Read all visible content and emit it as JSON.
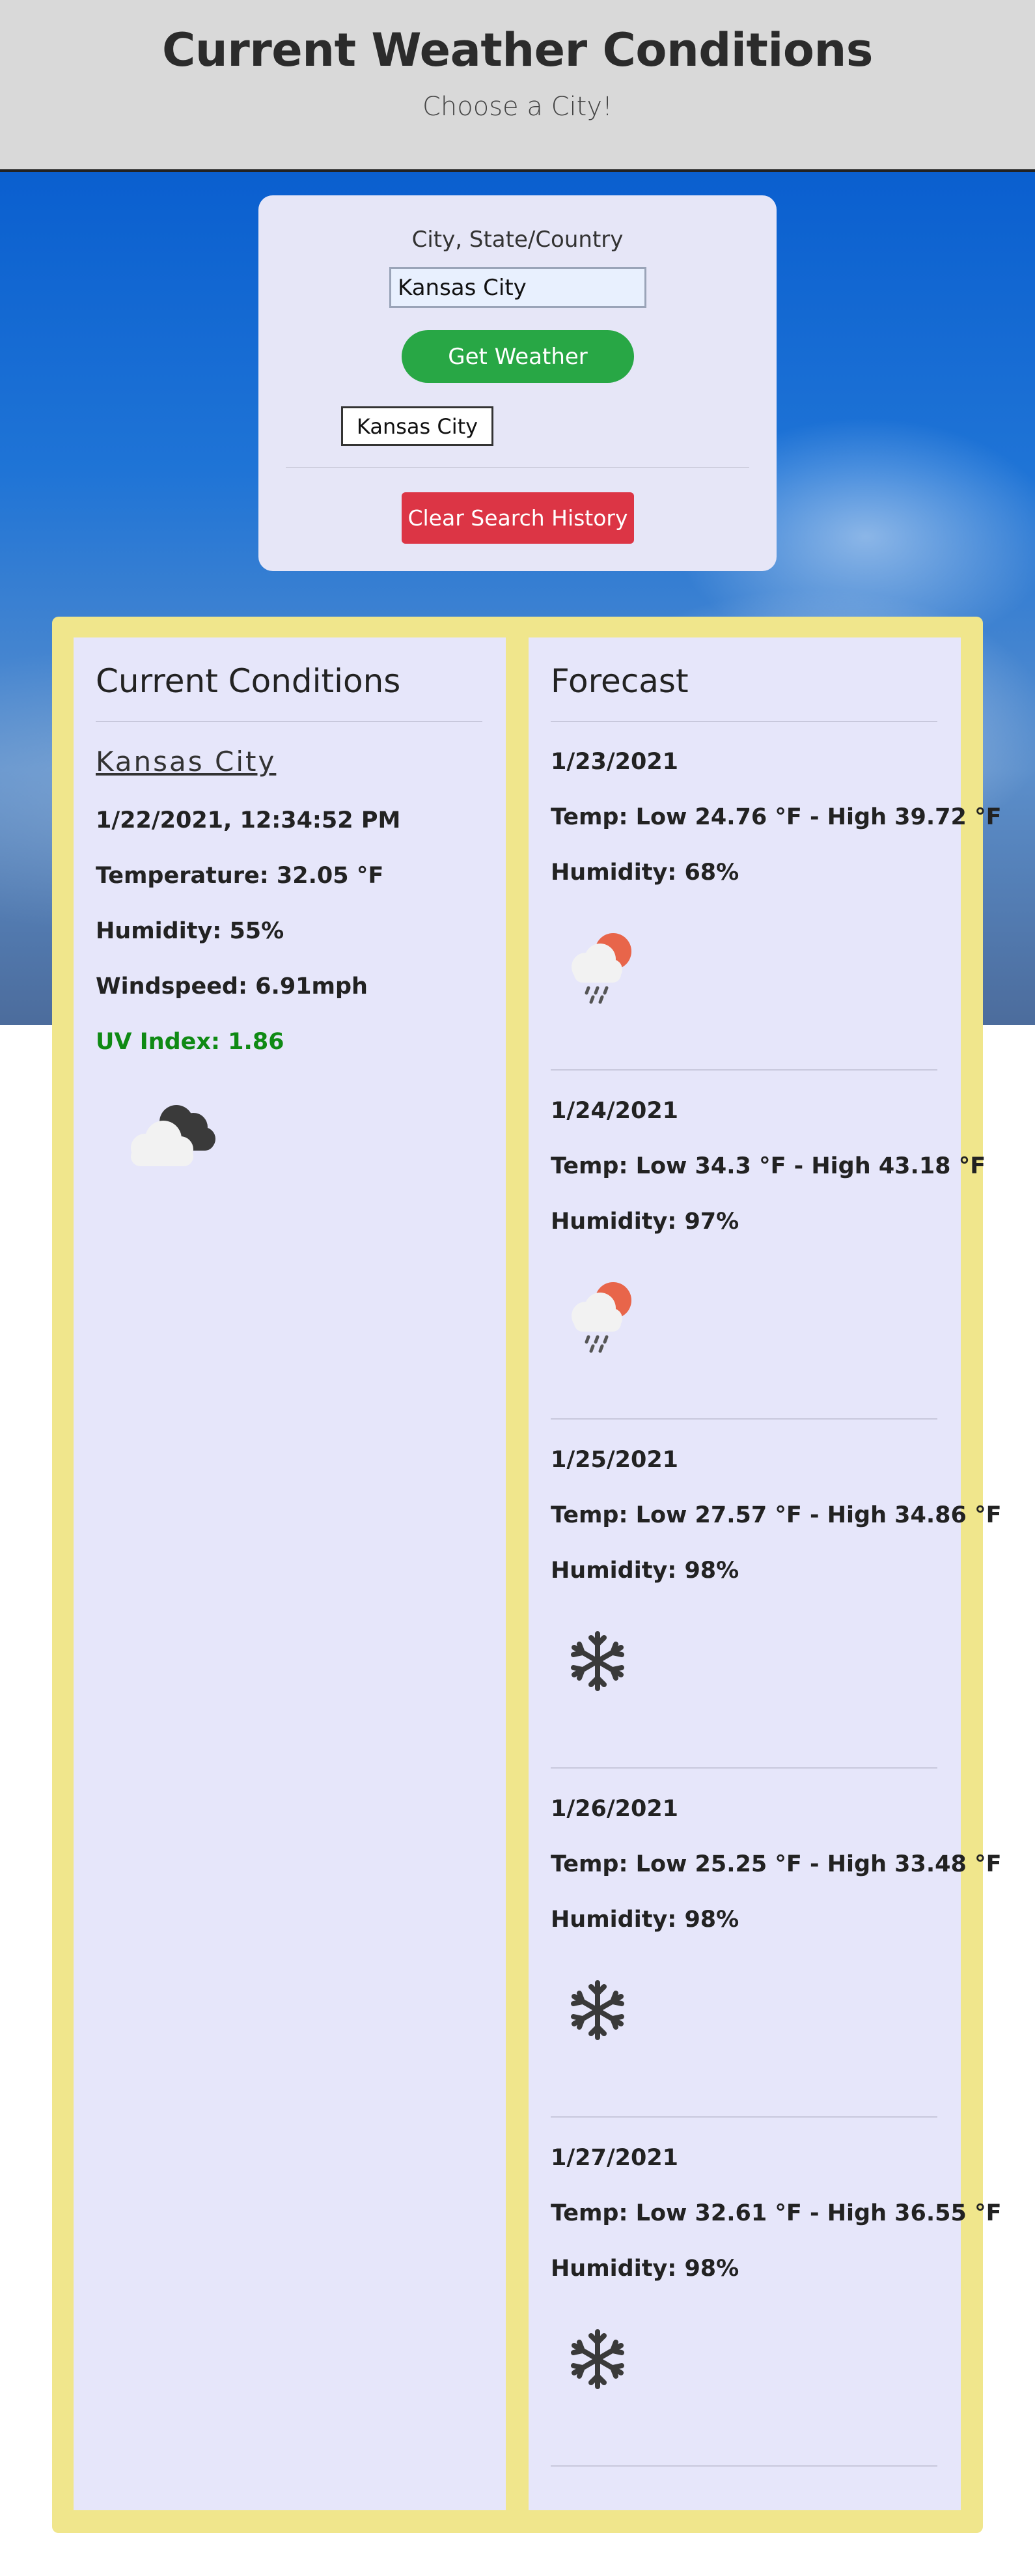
{
  "header": {
    "title": "Current Weather Conditions",
    "subtitle": "Choose a City!"
  },
  "search": {
    "label": "City, State/Country",
    "value": "Kansas City",
    "get_button": "Get Weather",
    "history": [
      "Kansas City"
    ],
    "clear_button": "Clear Search History"
  },
  "current": {
    "heading": "Current Conditions",
    "city": "Kansas City",
    "datetime": "1/22/2021, 12:34:52 PM",
    "temperature": "Temperature: 32.05 °F",
    "humidity": "Humidity: 55%",
    "windspeed": "Windspeed: 6.91mph",
    "uv": "UV Index: 1.86",
    "uv_color": "#0f8a14",
    "icon": "cloudy-icon"
  },
  "forecast": {
    "heading": "Forecast",
    "days": [
      {
        "date": "1/23/2021",
        "temp": "Temp: Low 24.76 °F - High 39.72 °F",
        "humidity": "Humidity: 68%",
        "icon": "sun-rain-cloud-icon"
      },
      {
        "date": "1/24/2021",
        "temp": "Temp: Low 34.3 °F - High 43.18 °F",
        "humidity": "Humidity: 97%",
        "icon": "sun-rain-cloud-icon"
      },
      {
        "date": "1/25/2021",
        "temp": "Temp: Low 27.57 °F - High 34.86 °F",
        "humidity": "Humidity: 98%",
        "icon": "snowflake-icon"
      },
      {
        "date": "1/26/2021",
        "temp": "Temp: Low 25.25 °F - High 33.48 °F",
        "humidity": "Humidity: 98%",
        "icon": "snowflake-icon"
      },
      {
        "date": "1/27/2021",
        "temp": "Temp: Low 32.61 °F - High 36.55 °F",
        "humidity": "Humidity: 98%",
        "icon": "snowflake-icon"
      }
    ]
  },
  "colors": {
    "header_bg": "#d9d9d9",
    "panel_bg": "#f0e68c",
    "card_bg": "#e6e6fa",
    "get_button": "#28a745",
    "clear_button": "#dc3545"
  }
}
